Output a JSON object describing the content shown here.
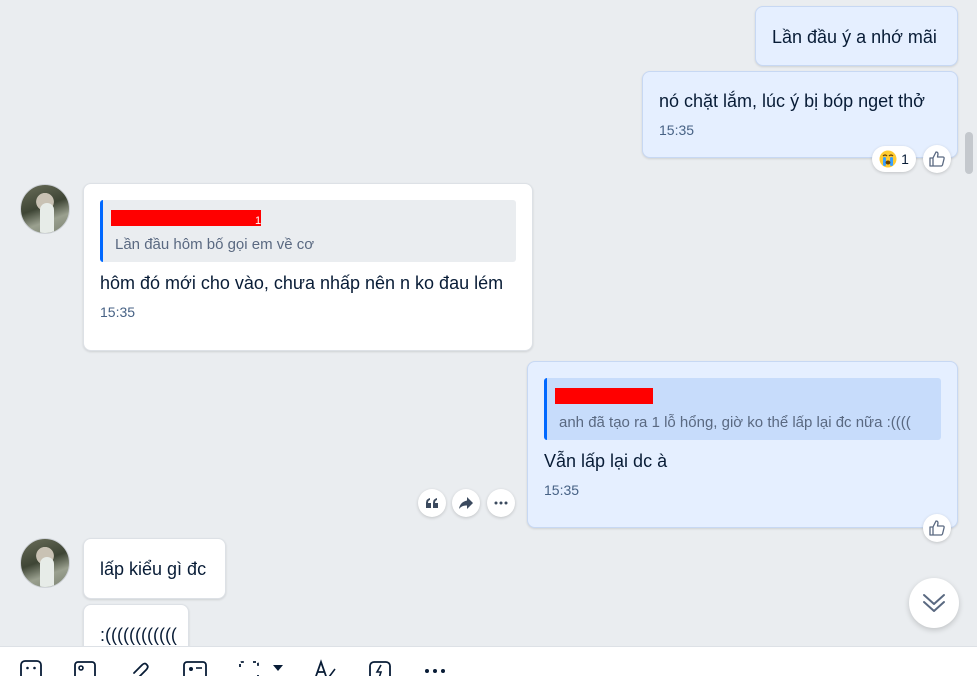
{
  "messages": [
    {
      "id": "m1",
      "text": "Lần đầu  ý a nhớ mãi"
    },
    {
      "id": "m2",
      "text": "nó chặt lắm, lúc ý bị bóp nget thở",
      "time": "15:35",
      "reaction_count": "1"
    },
    {
      "id": "m3",
      "quote_text": "Lần đầu hôm bố gọi em về cơ",
      "quote_author_visible": "1",
      "text": "hôm đó mới cho vào, chưa nhấp nên n ko đau lém",
      "time": "15:35"
    },
    {
      "id": "m4",
      "quote_text": "anh đã tạo ra 1 lỗ hổng, giờ ko thể lấp lại đc nữa :((((",
      "text": "Vẫn lấp lại dc à",
      "time": "15:35"
    },
    {
      "id": "m5",
      "text": "lấp kiểu gì đc"
    },
    {
      "id": "m6",
      "text": ":(((((((((((("
    }
  ],
  "icons": {
    "reaction_emoji": "crying-face",
    "like": "thumbs-up-icon",
    "quote": "quote-icon",
    "forward": "forward-icon",
    "more": "more-icon",
    "scroll_down": "double-chevron-down-icon",
    "toolbar": [
      "sticker-icon",
      "image-icon",
      "attachment-icon",
      "contact-card-icon",
      "screenshot-icon",
      "dropdown-caret-icon",
      "text-format-icon",
      "quick-message-icon",
      "more-icon"
    ]
  },
  "colors": {
    "background": "#eaedf0",
    "my_bubble": "#e5efff",
    "their_bubble": "#ffffff",
    "quote_bar": "#0068ff",
    "redaction": "#ff0000"
  }
}
